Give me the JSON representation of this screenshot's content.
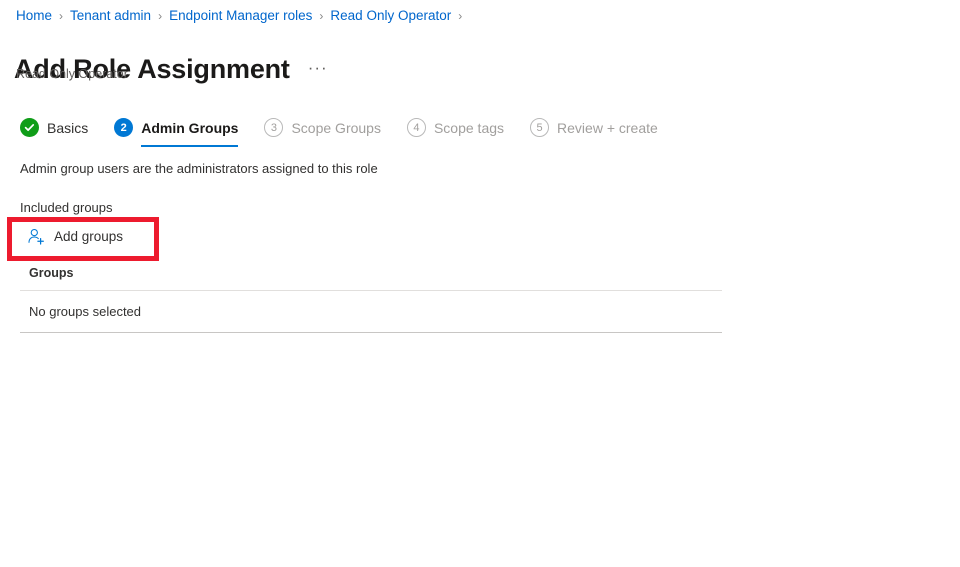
{
  "breadcrumb": {
    "separator": "›",
    "items": [
      {
        "label": "Home"
      },
      {
        "label": "Tenant admin"
      },
      {
        "label": "Endpoint Manager roles"
      },
      {
        "label": "Read Only Operator"
      }
    ]
  },
  "header": {
    "title": "Add Role Assignment",
    "more_actions": "···",
    "subtitle": "Read Only Operator"
  },
  "wizard": {
    "steps": [
      {
        "number": "1",
        "label": "Basics",
        "state": "done",
        "icon": "check-icon"
      },
      {
        "number": "2",
        "label": "Admin Groups",
        "state": "current",
        "icon": ""
      },
      {
        "number": "3",
        "label": "Scope Groups",
        "state": "pending",
        "icon": ""
      },
      {
        "number": "4",
        "label": "Scope tags",
        "state": "pending",
        "icon": ""
      },
      {
        "number": "5",
        "label": "Review + create",
        "state": "pending",
        "icon": ""
      }
    ]
  },
  "main": {
    "description": "Admin group users are the administrators assigned to this role",
    "included_groups_label": "Included groups",
    "add_groups": {
      "label": "Add groups",
      "icon": "person-add-icon"
    },
    "table": {
      "columns": [
        "Groups"
      ],
      "rows": [
        [
          "No groups selected"
        ]
      ]
    }
  },
  "colors": {
    "link": "#0066cc",
    "accent": "#0078d4",
    "success": "#0f9d18",
    "highlight": "#ed1b2e",
    "muted": "#a19f9d",
    "text": "#323130"
  }
}
